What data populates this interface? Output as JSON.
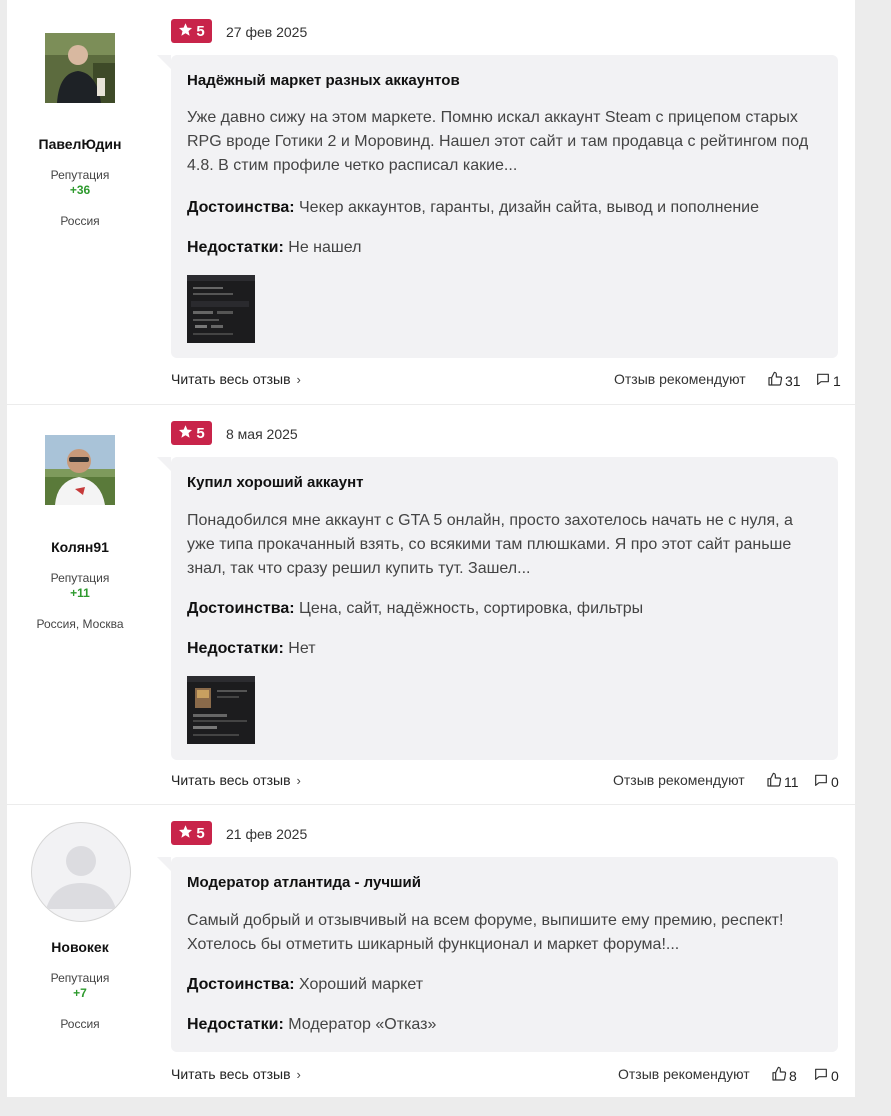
{
  "reviews": [
    {
      "author": {
        "name": "ПавелЮдин",
        "rep_label": "Репутация",
        "rep": "+36",
        "location": "Россия"
      },
      "rating": "5",
      "date": "27 фев 2025",
      "title": "Надёжный маркет разных аккаунтов",
      "text": "Уже давно сижу на этом маркете. Помню искал аккаунт Steam с прицепом старых RPG вроде Готики 2 и Моровинд. Нашел этот сайт и там продавца с рейтингом под 4.8. В стим профиле четко расписал какие...",
      "pros_label": "Достоинства:",
      "pros": "Чекер аккаунтов, гаранты, дизайн сайта, вывод и пополнение",
      "cons_label": "Недостатки:",
      "cons": "Не нашел",
      "read_all": "Читать весь отзыв",
      "recommend": "Отзыв рекомендуют",
      "likes": "31",
      "comments": "1"
    },
    {
      "author": {
        "name": "Колян91",
        "rep_label": "Репутация",
        "rep": "+11",
        "location": "Россия, Москва"
      },
      "rating": "5",
      "date": "8 мая 2025",
      "title": "Купил хороший аккаунт",
      "text": "Понадобился мне аккаунт с GTA 5 онлайн, просто захотелось начать не с нуля, а уже типа прокачанный взять, со всякими там плюшками. Я про этот сайт раньше знал, так что сразу решил купить тут. Зашел...",
      "pros_label": "Достоинства:",
      "pros": "Цена, сайт, надёжность, сортировка, фильтры",
      "cons_label": "Недостатки:",
      "cons": "Нет",
      "read_all": "Читать весь отзыв",
      "recommend": "Отзыв рекомендуют",
      "likes": "11",
      "comments": "0"
    },
    {
      "author": {
        "name": "Новокек",
        "rep_label": "Репутация",
        "rep": "+7",
        "location": "Россия"
      },
      "rating": "5",
      "date": "21 фев 2025",
      "title": "Модератор атлантида - лучший",
      "text": "Самый добрый и отзывчивый на всем форуме, выпишите ему премию, респект! Хотелось бы отметить шикарный функционал и маркет форума!...",
      "pros_label": "Достоинства:",
      "pros": "Хороший маркет",
      "cons_label": "Недостатки:",
      "cons": "Модератор «Отказ»",
      "read_all": "Читать весь отзыв",
      "recommend": "Отзыв рекомендуют",
      "likes": "8",
      "comments": "0"
    }
  ],
  "icons": {
    "star": "star-icon",
    "like": "thumbs-up-icon",
    "comment": "comment-icon",
    "chevron": "chevron-right-icon",
    "avatar_placeholder": "user-placeholder-icon"
  },
  "colors": {
    "badge": "#c8244a",
    "reputation": "#2e9a2e",
    "bubble": "#f2f2f4"
  }
}
